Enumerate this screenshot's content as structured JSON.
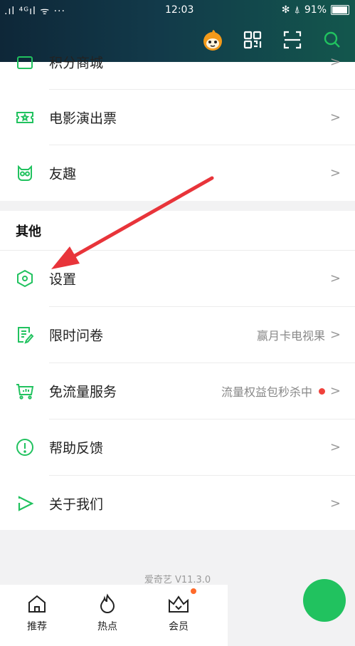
{
  "status_bar": {
    "signal": ".ıl ⁴ᴳıl ᯤ ···",
    "time": "12:03",
    "battery_percent": "91%",
    "battery_level": 0.91
  },
  "header": {
    "icons": [
      "mascot-avatar-icon",
      "qr-code-icon",
      "scan-icon",
      "search-icon"
    ],
    "accent_color": "#21c25f"
  },
  "menu_top": {
    "partial_label": "积分商城",
    "items": [
      {
        "label": "电影演出票",
        "icon": "ticket-icon"
      },
      {
        "label": "友趣",
        "icon": "friends-owl-icon"
      }
    ]
  },
  "other_section": {
    "title": "其他",
    "items": [
      {
        "label": "设置",
        "icon": "settings-hexagon-icon"
      },
      {
        "label": "限时问卷",
        "icon": "survey-icon",
        "sub": "赢月卡电视果"
      },
      {
        "label": "免流量服务",
        "icon": "cart-icon",
        "sub": "流量权益包秒杀中"
      },
      {
        "label": "帮助反馈",
        "icon": "help-exclamation-icon"
      },
      {
        "label": "关于我们",
        "icon": "about-play-icon"
      }
    ]
  },
  "version": "爱奇艺 V11.3.0",
  "tabbar": [
    {
      "label": "推荐",
      "icon": "home-icon"
    },
    {
      "label": "热点",
      "icon": "flame-icon"
    },
    {
      "label": "会员",
      "icon": "crown-icon"
    }
  ],
  "annotation": {
    "type": "red-arrow",
    "points_to": "设置"
  }
}
